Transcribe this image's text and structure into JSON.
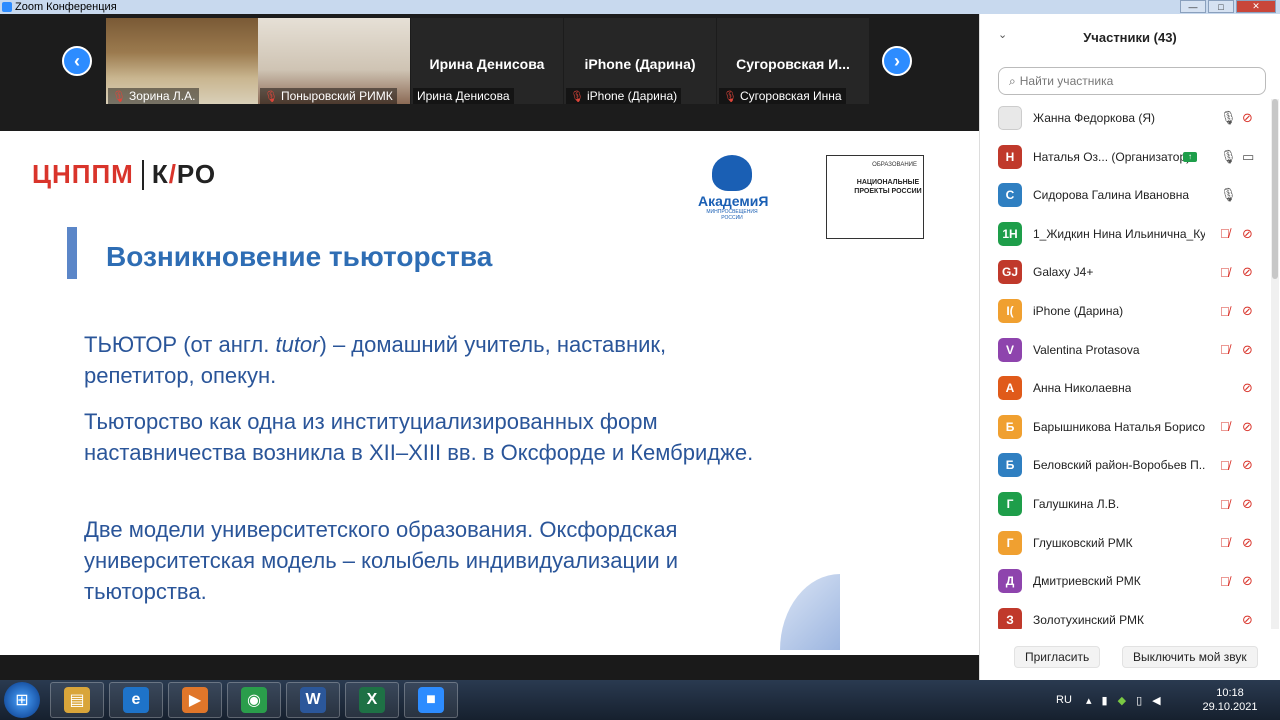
{
  "window": {
    "title": "Zoom Конференция"
  },
  "strip": {
    "tiles": [
      {
        "label": "Зорина Л.А.",
        "muted": true,
        "name": ""
      },
      {
        "label": "Поныровский РИМК",
        "muted": true,
        "name": ""
      },
      {
        "label": "Ирина Денисова",
        "muted": false,
        "name": "Ирина Денисова"
      },
      {
        "label": "iPhone (Дарина)",
        "muted": true,
        "name": "iPhone (Дарина)"
      },
      {
        "label": "Сугоровская Инна",
        "muted": true,
        "name": "Сугоровская  И..."
      }
    ]
  },
  "slide": {
    "logo_left_a": "ЦНППМ",
    "logo_left_b": "К",
    "logo_left_c": "РО",
    "akademia": "АкадемиЯ",
    "akademia_sub": "МИНПРОСВЕЩЕНИЯ РОССИИ",
    "nac_small": "ОБРАЗОВАНИЕ",
    "nac_big": "НАЦИОНАЛЬНЫЕ ПРОЕКТЫ РОССИИ",
    "title": "Возникновение тьюторства",
    "p1_a": "ТЬЮТОР (от англ. ",
    "p1_em": "tutor",
    "p1_b": ") – домашний учитель, наставник, репетитор, опекун.",
    "p2": "Тьюторство как одна из институциализированных форм наставничества возникла в XII–XIII вв. в Оксфорде и Кембридже.",
    "p3": "Две модели университетского образования. Оксфордская университетская модель – колыбель индивидуализации и тьюторства."
  },
  "panel": {
    "title": "Участники (43)",
    "search_placeholder": "Найти участника",
    "participants": [
      {
        "initials": "",
        "color": "#e8e8e8",
        "name": "Жанна Федоркова (Я)",
        "mic": "on",
        "cam": "off",
        "host_badge": false
      },
      {
        "initials": "Н",
        "color": "#c0392b",
        "name": "Наталья Оз... (Организатор)",
        "mic": "on",
        "cam": "on",
        "host_badge": true
      },
      {
        "initials": "С",
        "color": "#2f7fc1",
        "name": "Сидорова Галина Ивановна",
        "mic": "on",
        "cam": "none",
        "host_badge": false
      },
      {
        "initials": "1Н",
        "color": "#1e9e4a",
        "name": "1_Жидкин Нина Ильинична_Ку...",
        "mic": "off",
        "cam": "off",
        "host_badge": false
      },
      {
        "initials": "GJ",
        "color": "#c0392b",
        "name": "Galaxy J4+",
        "mic": "off",
        "cam": "off",
        "host_badge": false
      },
      {
        "initials": "I(",
        "color": "#f0a030",
        "name": "iPhone (Дарина)",
        "mic": "off",
        "cam": "off",
        "host_badge": false
      },
      {
        "initials": "V",
        "color": "#8e44ad",
        "name": "Valentina Protasova",
        "mic": "off",
        "cam": "off",
        "host_badge": false
      },
      {
        "initials": "А",
        "color": "#e05a1a",
        "name": "Анна Николаевна",
        "mic": "none",
        "cam": "off",
        "host_badge": false
      },
      {
        "initials": "Б",
        "color": "#f0a030",
        "name": "Барышникова Наталья Борисо...",
        "mic": "off",
        "cam": "off",
        "host_badge": false
      },
      {
        "initials": "Б",
        "color": "#2f7fc1",
        "name": "Беловский район-Воробьев П...",
        "mic": "off",
        "cam": "off",
        "host_badge": false
      },
      {
        "initials": "Г",
        "color": "#1e9e4a",
        "name": "Галушкина Л.В.",
        "mic": "off",
        "cam": "off",
        "host_badge": false
      },
      {
        "initials": "Г",
        "color": "#f0a030",
        "name": "Глушковский РМК",
        "mic": "off",
        "cam": "off",
        "host_badge": false
      },
      {
        "initials": "Д",
        "color": "#8e44ad",
        "name": "Дмитриевский РМК",
        "mic": "off",
        "cam": "off",
        "host_badge": false
      },
      {
        "initials": "З",
        "color": "#c0392b",
        "name": "Золотухинский РМК",
        "mic": "none",
        "cam": "off",
        "host_badge": false
      }
    ],
    "invite_label": "Пригласить",
    "mute_label": "Выключить мой звук"
  },
  "taskbar": {
    "lang": "RU",
    "time": "10:18",
    "date": "29.10.2021",
    "apps": [
      {
        "name": "explorer",
        "glyph": "▤",
        "color": "#d9a53a"
      },
      {
        "name": "ie",
        "glyph": "e",
        "color": "#1e73c9"
      },
      {
        "name": "media",
        "glyph": "▶",
        "color": "#e0762a"
      },
      {
        "name": "chrome",
        "glyph": "◉",
        "color": "#2a9d4b"
      },
      {
        "name": "word",
        "glyph": "W",
        "color": "#2b579a"
      },
      {
        "name": "excel",
        "glyph": "X",
        "color": "#1e7145"
      },
      {
        "name": "zoom",
        "glyph": "■",
        "color": "#2d8cff"
      }
    ]
  }
}
